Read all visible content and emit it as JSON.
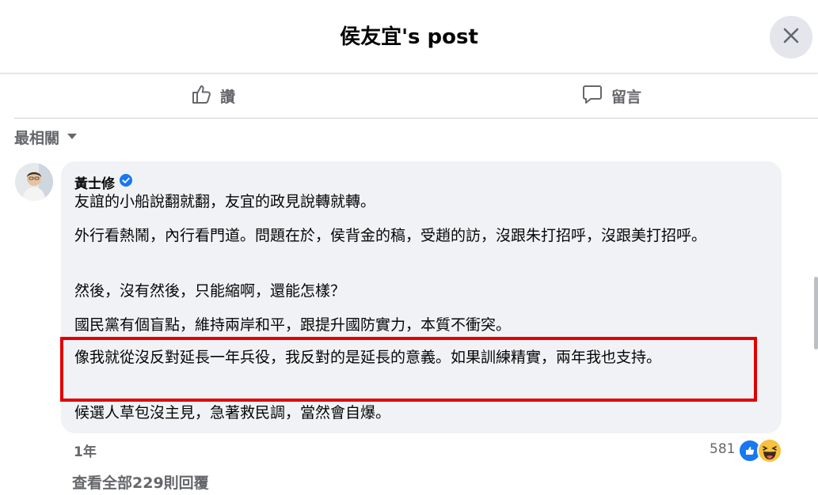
{
  "header": {
    "title": "侯友宜's post"
  },
  "actions": {
    "like_label": "讚",
    "comment_label": "留言"
  },
  "sort": {
    "label": "最相關"
  },
  "comment": {
    "author": "黃士修",
    "verified": true,
    "paragraphs": [
      "友誼的小船說翻就翻，友宜的政見說轉就轉。",
      "外行看熱鬧，內行看門道。問題在於，侯背金的稿，受趙的訪，沒跟朱打招呼，沒跟美打招呼。",
      "然後，沒有然後，只能縮啊，還能怎樣？",
      "國民黨有個盲點，維持兩岸和平，跟提升國防實力，本質不衝突。",
      "像我就從沒反對延長一年兵役，我反對的是延長的意義。如果訓練精實，兩年我也支持。",
      "候選人草包沒主見，急著救民調，當然會自爆。"
    ],
    "time": "1年",
    "reaction_count": "581",
    "reaction_icons": [
      "like-icon",
      "haha-icon"
    ]
  },
  "view_replies": "查看全部229則回覆",
  "colors": {
    "highlight_border": "#e00000",
    "bubble_bg": "#f0f2f5",
    "secondary_text": "#65676b",
    "verified": "#1877f2"
  }
}
